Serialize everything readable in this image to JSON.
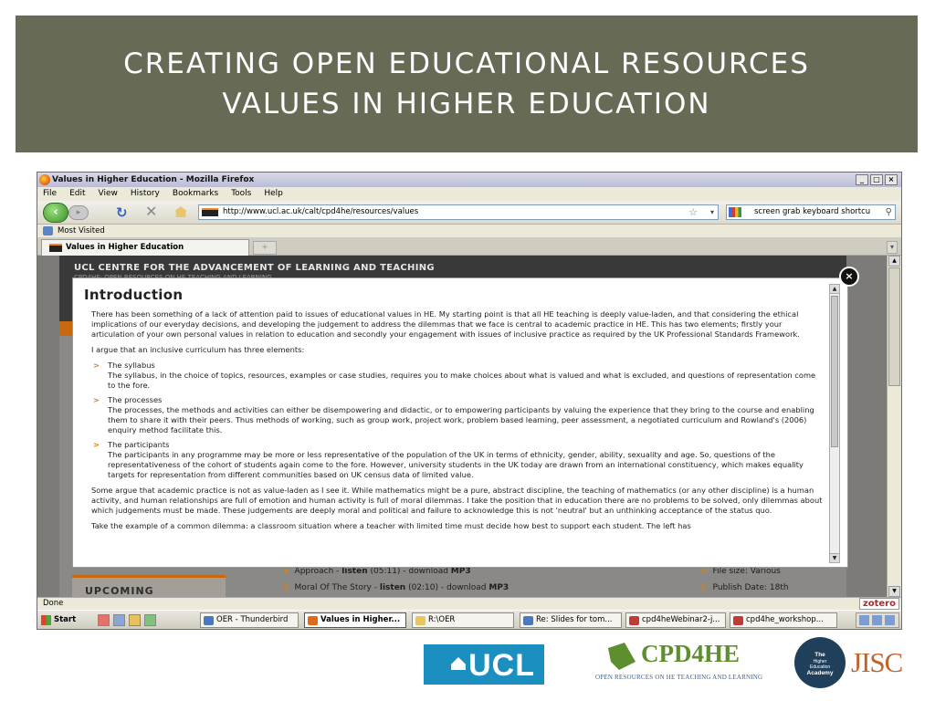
{
  "slide": {
    "title_line1": "CREATING OPEN EDUCATIONAL RESOURCES",
    "title_line2": "VALUES IN HIGHER EDUCATION"
  },
  "browser": {
    "window_title": "Values in Higher Education - Mozilla Firefox",
    "window_controls": [
      "_",
      "□",
      "×"
    ],
    "menu": [
      "File",
      "Edit",
      "View",
      "History",
      "Bookmarks",
      "Tools",
      "Help"
    ],
    "url": "http://www.ucl.ac.uk/calt/cpd4he/resources/values",
    "search_value": "screen grab keyboard shortcu",
    "bookmark": "Most Visited",
    "tab_title": "Values in Higher Education",
    "status": "Done",
    "zotero": "zotero"
  },
  "page": {
    "header_title": "UCL CENTRE FOR THE ADVANCEMENT OF LEARNING AND TEACHING",
    "header_subtitle": "CPD4HE: OPEN RESOURCES ON HE TEACHING AND LEARNING",
    "upcoming": "UPCOMING",
    "links": [
      {
        "text": "Approach - ",
        "bold": "listen",
        "mid": " (05:11) - download ",
        "bold2": "MP3"
      },
      {
        "text": "Moral Of The Story - ",
        "bold": "listen",
        "mid": " (02:10) - download ",
        "bold2": "MP3"
      }
    ],
    "meta": [
      "File size: Various",
      "Publish Date: 18th"
    ]
  },
  "modal": {
    "close": "×",
    "title": "Introduction",
    "p1": "There has been something of a lack of attention paid to issues of educational values in HE. My starting point is that all HE teaching is deeply value-laden, and that considering the ethical implications of our everyday decisions, and developing the judgement to address the dilemmas that we face is central to academic practice in HE. This has two elements; firstly your articulation of your own personal values in relation to education and secondly your engagement with issues of inclusive practice as required by the UK Professional Standards Framework.",
    "p2": "I argue that an inclusive curriculum has three elements:",
    "items": [
      {
        "head": "The syllabus",
        "body": "The syllabus, in the choice of topics, resources, examples or case studies, requires you to make choices about what is valued and what is excluded, and questions of representation come to the fore."
      },
      {
        "head": "The processes",
        "body": "The processes, the methods and activities can either be disempowering and didactic, or to empowering participants by valuing the experience that they bring to the course and enabling them to share it with their peers. Thus methods of working, such as group work, project work, problem based learning, peer assessment, a negotiated curriculum and Rowland's (2006) enquiry method facilitate this."
      },
      {
        "head": "The participants",
        "body": "The participants in any programme may be more or less representative of the population of the UK in terms of ethnicity, gender, ability, sexuality and age. So, questions of the representativeness of the cohort of students again come to the fore. However, university students in the UK today are drawn from an international constituency, which makes equality targets for representation from different communities based on UK census data of limited value."
      }
    ],
    "p3": "Some argue that academic practice is not as value-laden as I see it. While mathematics might be a pure, abstract discipline, the teaching of mathematics (or any other discipline) is a human activity, and human relationships are full of emotion and human activity is full of moral dilemmas. I take the position that in education there are no problems to be solved, only dilemmas about which judgements must be made. These judgements are deeply moral and political and failure to acknowledge this is not 'neutral' but an unthinking acceptance of the status quo.",
    "p4": "Take the example of a common dilemma: a classroom situation where a teacher with limited time must decide how best to support each student. The left has"
  },
  "taskbar": {
    "start": "Start",
    "tasks": [
      {
        "label": "OER - Thunderbird",
        "color": "#4a78c2"
      },
      {
        "label": "Values in Higher...",
        "color": "#e06a1b"
      },
      {
        "label": "R:\\OER",
        "color": "#e8c65e"
      },
      {
        "label": "Re: Slides for tom...",
        "color": "#4a78c2"
      },
      {
        "label": "cpd4heWebinar2-j...",
        "color": "#c23b3b"
      },
      {
        "label": "cpd4he_workshop...",
        "color": "#c23b3b"
      }
    ]
  },
  "logos": {
    "ucl": "UCL",
    "cpd_name": "CPD4HE",
    "cpd_tag": "OPEN RESOURCES ON HE TEACHING AND LEARNING",
    "hea_line1": "The",
    "hea_line2": "Higher",
    "hea_line3": "Education",
    "hea_line4": "Academy",
    "jisc": "JISC"
  }
}
